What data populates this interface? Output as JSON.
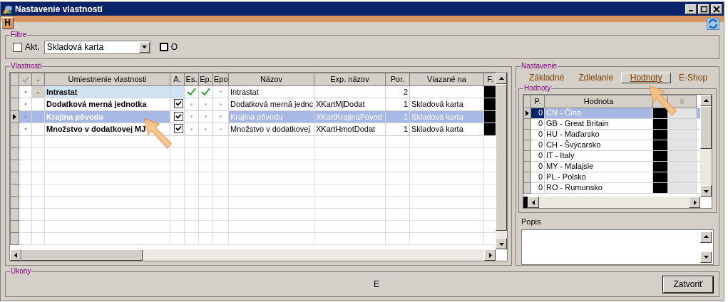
{
  "window": {
    "title": "Nastavenie vlastností"
  },
  "toolbar": {
    "button": "H"
  },
  "filter": {
    "title": "Filtre",
    "akt": {
      "label": "Akt.",
      "checked": false
    },
    "dropdown": {
      "value": "Skladová karta"
    },
    "o": {
      "label": "O",
      "checked": false
    }
  },
  "properties": {
    "title": "Vlastnosti",
    "columns": [
      "-",
      "Umiestnenie vlastnosti",
      "A.",
      "Es.",
      "Ep.",
      "Epo",
      "Názov",
      "Exp. názov",
      "Por.",
      "Viazané na",
      "F."
    ],
    "rows": [
      {
        "kind": "group",
        "expander": "-",
        "location": "Intrastat",
        "es_checked": true,
        "ep_checked": true,
        "name": "Intrastat",
        "order": "2",
        "selected": false
      },
      {
        "kind": "item",
        "location": "Dodatková merná jednotka",
        "a_checked": true,
        "es_checked": false,
        "ep_checked": false,
        "name": "Dodatková merná jednc",
        "exp_name": "XKartMjDodat",
        "order": "1",
        "bound_to": "Skladová karta",
        "selected": false
      },
      {
        "kind": "item",
        "location": "Krajina pôvodu",
        "a_checked": true,
        "es_checked": false,
        "ep_checked": false,
        "name": "Krajina pôvodu",
        "exp_name": "XKartKrajinaPovod",
        "order": "1",
        "bound_to": "Skladová karta",
        "selected": true
      },
      {
        "kind": "item",
        "location": "Množstvo v dodatkovej MJ",
        "a_checked": true,
        "es_checked": false,
        "ep_checked": false,
        "name": "Množstvo v dodatkovej",
        "exp_name": "XKartHmotDodat",
        "order": "1",
        "bound_to": "Skladová karta",
        "selected": false
      }
    ]
  },
  "settings": {
    "title": "Nastavenie",
    "tabs": [
      {
        "label": "Základné",
        "selected": false
      },
      {
        "label": "Zdielanie",
        "selected": false
      },
      {
        "label": "Hodnoty",
        "selected": true
      },
      {
        "label": "E-Shop",
        "selected": false
      }
    ],
    "values": {
      "title": "Hodnoty",
      "columns": [
        "P.",
        "Hodnota"
      ],
      "rows": [
        {
          "order": "0",
          "value": "CN - Čína",
          "selected": true
        },
        {
          "order": "0",
          "value": "GB - Great Britain",
          "selected": false
        },
        {
          "order": "0",
          "value": "HU - Maďarsko",
          "selected": false
        },
        {
          "order": "0",
          "value": "CH - Švýcarsko",
          "selected": false
        },
        {
          "order": "0",
          "value": "IT - Italy",
          "selected": false
        },
        {
          "order": "0",
          "value": "MY - Malajsie",
          "selected": false
        },
        {
          "order": "0",
          "value": "PL - Polsko",
          "selected": false
        },
        {
          "order": "0",
          "value": "RO - Rumunsko",
          "selected": false
        }
      ]
    },
    "description": {
      "label": "Popis"
    }
  },
  "actions": {
    "title": "Úkony",
    "center_text": "E",
    "close_button": "Zatvoriť"
  }
}
